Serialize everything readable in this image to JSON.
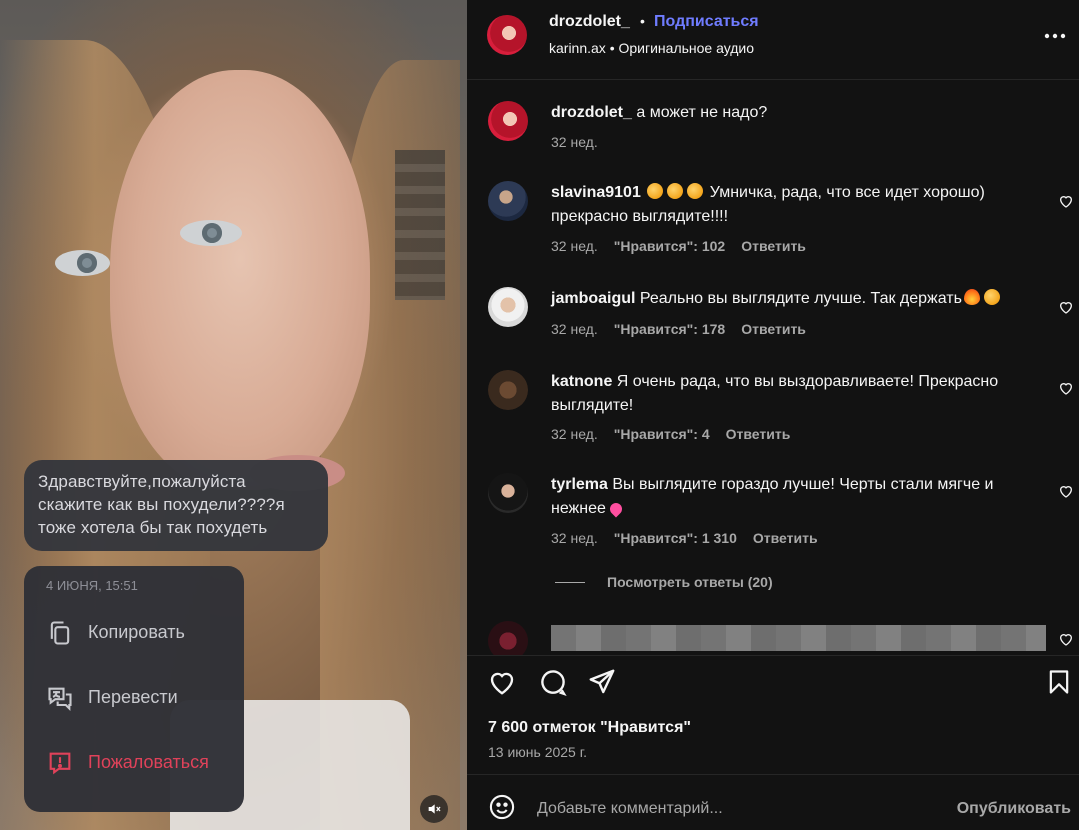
{
  "media": {
    "dm_message": "Здравствуйте,пожалуйста скажите как вы похудели????я тоже хотела бы так похудеть",
    "context_menu": {
      "date": "4 ИЮНЯ, 15:51",
      "items": [
        {
          "label": "Копировать",
          "icon": "copy-icon"
        },
        {
          "label": "Перевести",
          "icon": "translate-icon"
        },
        {
          "label": "Пожаловаться",
          "icon": "report-icon"
        }
      ]
    },
    "mute_icon": "muted-speaker-icon"
  },
  "header": {
    "username": "drozdolet_",
    "separator": "•",
    "follow_label": "Подписаться",
    "audio_user": "karinn.ax",
    "audio_separator": "•",
    "audio_label": "Оригинальное аудио",
    "more_icon": "more-horizontal-icon"
  },
  "caption": {
    "username": "drozdolet_",
    "text": "а может не надо?",
    "time": "32 нед."
  },
  "comments": [
    {
      "username": "slavina9101",
      "emoji": [
        "clap",
        "clap",
        "clap"
      ],
      "text": "Умничка, рада, что все идет хорошо) прекрасно выглядите!!!!",
      "time": "32 нед.",
      "likes": "\"Нравится\": 102",
      "reply": "Ответить"
    },
    {
      "username": "jamboaigul",
      "text": "Реально вы выглядите лучше. Так держать",
      "emoji_after": [
        "fire",
        "clap"
      ],
      "time": "32 нед.",
      "likes": "\"Нравится\": 178",
      "reply": "Ответить"
    },
    {
      "username": "katnone",
      "text": "Я очень рада, что вы выздоравливаете! Прекрасно выглядите!",
      "time": "32 нед.",
      "likes": "\"Нравится\": 4",
      "reply": "Ответить"
    },
    {
      "username": "tyrlema",
      "text": "Вы выглядите гораздо лучше! Черты стали мягче и нежнее",
      "emoji_after": [
        "pink-heart"
      ],
      "time": "32 нед.",
      "likes": "\"Нравится\": 1 310",
      "reply": "Ответить"
    }
  ],
  "view_replies": "Посмотреть ответы (20)",
  "actions": {
    "icons": [
      "heart-icon",
      "comment-icon",
      "share-icon",
      "bookmark-icon"
    ],
    "likes_count": "7 600 отметок \"Нравится\"",
    "date": "13 июнь 2025 г."
  },
  "add_comment": {
    "placeholder": "Добавьте комментарий...",
    "post_label": "Опубликовать"
  },
  "colors": {
    "background": "#121212",
    "accent_link": "#6f7cff",
    "secondary_text": "#a8a8a8",
    "danger": "#e0425a"
  }
}
